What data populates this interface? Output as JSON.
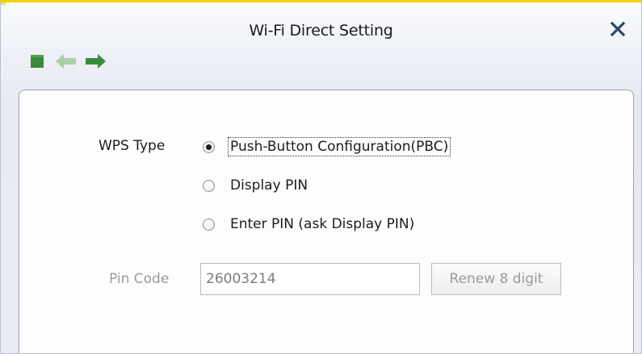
{
  "window": {
    "title": "Wi-Fi Direct Setting",
    "close_icon": "close-icon"
  },
  "toolbar": {
    "stop_icon": "stop-icon",
    "back_icon": "back-arrow-icon",
    "forward_icon": "forward-arrow-icon",
    "colors": {
      "stop": "#3b8a3b",
      "back_disabled": "#a9cfa9",
      "forward": "#3b8a3b"
    }
  },
  "wps": {
    "type_label": "WPS Type",
    "options": [
      {
        "label": "Push-Button Configuration(PBC)",
        "selected": true
      },
      {
        "label": "Display PIN",
        "selected": false
      },
      {
        "label": "Enter PIN (ask Display PIN)",
        "selected": false
      }
    ]
  },
  "pin": {
    "label": "Pin Code",
    "value": "26003214",
    "renew_label": "Renew 8 digit"
  }
}
